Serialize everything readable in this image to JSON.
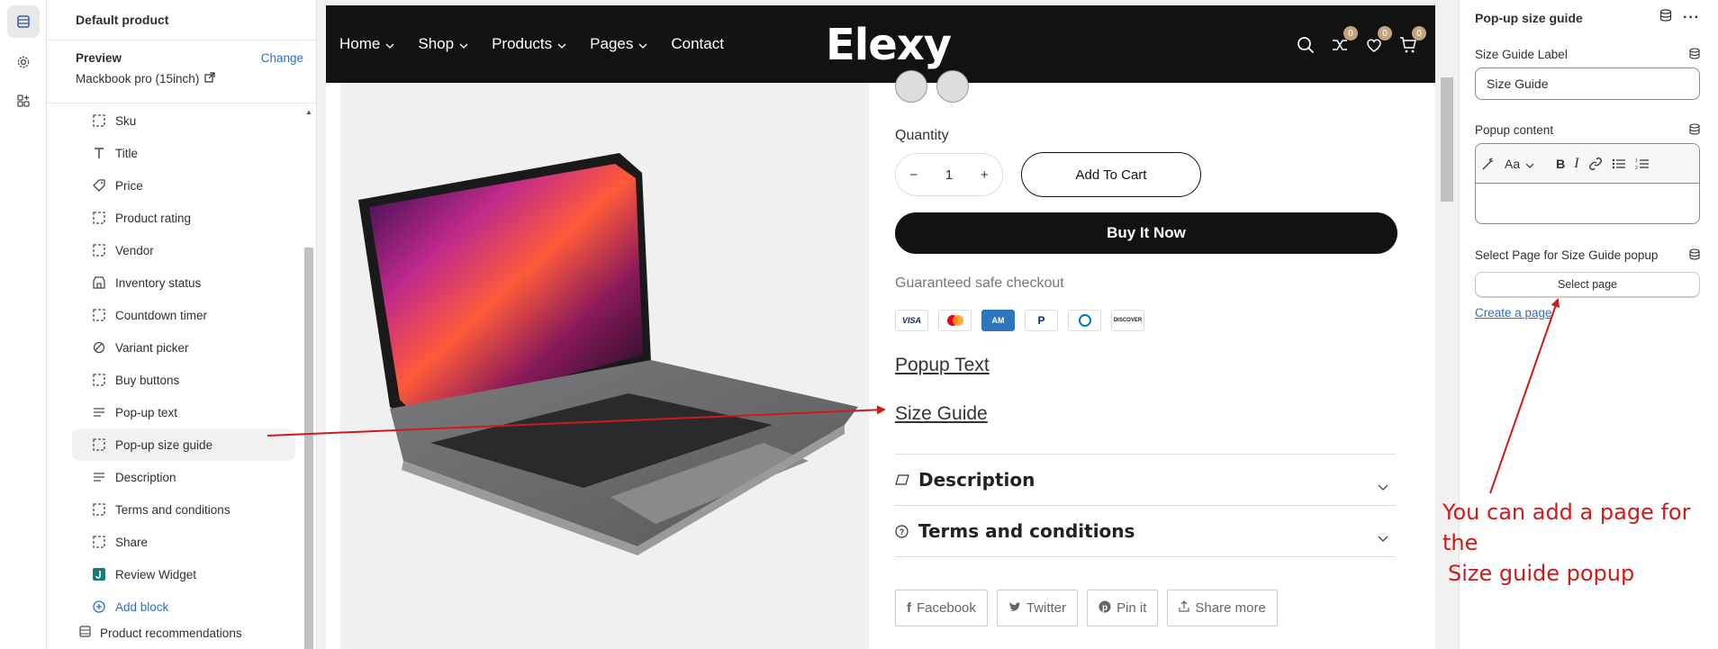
{
  "sidebar": {
    "title": "Default product",
    "preview_label": "Preview",
    "change_label": "Change",
    "preview_value": "Mackbook pro (15inch)",
    "blocks": [
      {
        "label": "Sku",
        "icon": "dashed-square-icon"
      },
      {
        "label": "Title",
        "icon": "title-t-icon"
      },
      {
        "label": "Price",
        "icon": "price-tag-icon"
      },
      {
        "label": "Product rating",
        "icon": "dashed-square-icon"
      },
      {
        "label": "Vendor",
        "icon": "dashed-square-icon"
      },
      {
        "label": "Inventory status",
        "icon": "store-icon"
      },
      {
        "label": "Countdown timer",
        "icon": "dashed-square-icon"
      },
      {
        "label": "Variant picker",
        "icon": "variant-icon"
      },
      {
        "label": "Buy buttons",
        "icon": "dashed-square-icon"
      },
      {
        "label": "Pop-up text",
        "icon": "text-lines-icon"
      },
      {
        "label": "Pop-up size guide",
        "icon": "dashed-square-icon"
      },
      {
        "label": "Description",
        "icon": "text-lines-icon"
      },
      {
        "label": "Terms and conditions",
        "icon": "dashed-square-icon"
      },
      {
        "label": "Share",
        "icon": "dashed-square-icon"
      },
      {
        "label": "Review Widget",
        "icon": "judgeme-icon"
      }
    ],
    "add_block": "Add block",
    "product_recommendations": "Product recommendations"
  },
  "store": {
    "nav": [
      "Home",
      "Shop",
      "Products",
      "Pages",
      "Contact"
    ],
    "logo": "Elexy",
    "badges": [
      "0",
      "0",
      "0"
    ],
    "quantity_label": "Quantity",
    "quantity_value": "1",
    "qty_minus": "−",
    "qty_plus": "+",
    "add_to_cart": "Add To Cart",
    "buy_now": "Buy It Now",
    "safe_checkout": "Guaranteed safe checkout",
    "payments": [
      "VISA",
      "MC",
      "AMEX",
      "PayPal",
      "Diners",
      "DISCOVER"
    ],
    "popup_text": "Popup Text",
    "size_guide": "Size Guide",
    "accordion": [
      "Description",
      "Terms and conditions"
    ],
    "share": [
      "Facebook",
      "Twitter",
      "Pin it",
      "Share more"
    ]
  },
  "settings": {
    "title": "Pop-up size guide",
    "label_label": "Size Guide Label",
    "label_value": "Size Guide",
    "popup_content_label": "Popup content",
    "rte_format": "Aa",
    "rte_bold": "B",
    "rte_italic": "I",
    "select_page_label": "Select Page for Size Guide popup",
    "select_page_button": "Select page",
    "create_page_link": "Create a page"
  },
  "annotation": {
    "text_line1": "You can add a page for the",
    "text_line2": "Size guide popup",
    "color": "#d01a1a"
  },
  "colors": {
    "accent_link": "#2c6ecb",
    "nav_bg": "#121212",
    "badge": "#c4a47c"
  }
}
